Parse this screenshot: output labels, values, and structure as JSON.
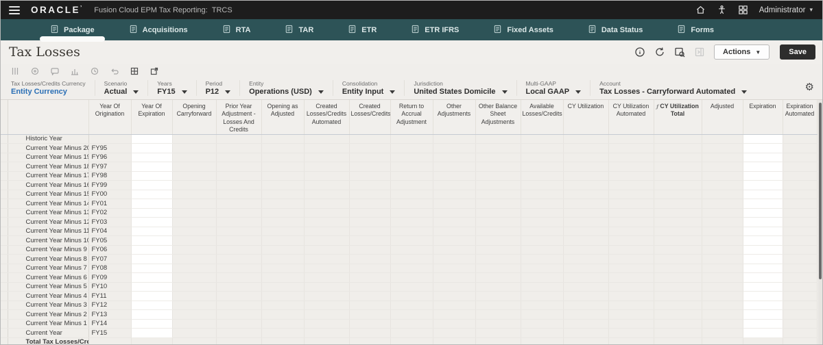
{
  "colors": {
    "topbar_bg": "#1d1d1d",
    "tabbar_bg": "#2d5357",
    "page_bg": "#f0eeeb",
    "link_blue": "#2a6fb5",
    "cell_readonly": "#f0eeea",
    "cell_editable": "#ffffff",
    "save_button_bg": "#2d2d2d"
  },
  "topbar": {
    "brand": "ORACLE",
    "product": "Fusion Cloud EPM Tax Reporting:",
    "app": "TRCS",
    "user": "Administrator",
    "icons": [
      "home-icon",
      "accessibility-icon",
      "apps-grid-icon"
    ]
  },
  "tabs": [
    {
      "id": "package",
      "label": "Package",
      "active": true
    },
    {
      "id": "acquisitions",
      "label": "Acquisitions",
      "active": false
    },
    {
      "id": "rta",
      "label": "RTA",
      "active": false
    },
    {
      "id": "tar",
      "label": "TAR",
      "active": false
    },
    {
      "id": "etr",
      "label": "ETR",
      "active": false
    },
    {
      "id": "etr-ifrs",
      "label": "ETR IFRS",
      "active": false
    },
    {
      "id": "fixed-assets",
      "label": "Fixed Assets",
      "active": false
    },
    {
      "id": "data-status",
      "label": "Data Status",
      "active": false
    },
    {
      "id": "forms",
      "label": "Forms",
      "active": false
    }
  ],
  "page": {
    "title": "Tax Losses",
    "actions_label": "Actions",
    "save_label": "Save",
    "title_icons": [
      "info-icon",
      "refresh-icon",
      "form-inspect-icon",
      "expand-panel-icon"
    ]
  },
  "toolbar_icons": [
    "freeze-columns-icon",
    "target-icon",
    "comment-icon",
    "chart-icon",
    "history-icon",
    "undo-icon",
    "grid-view-icon",
    "open-window-icon"
  ],
  "pov": [
    {
      "id": "currency",
      "label": "Tax Losses/Credits Currency",
      "value": "Entity Currency",
      "type": "link"
    },
    {
      "id": "scenario",
      "label": "Scenario",
      "value": "Actual",
      "type": "dropdown"
    },
    {
      "id": "years",
      "label": "Years",
      "value": "FY15",
      "type": "dropdown"
    },
    {
      "id": "period",
      "label": "Period",
      "value": "P12",
      "type": "dropdown"
    },
    {
      "id": "entity",
      "label": "Entity",
      "value": "Operations (USD)",
      "type": "dropdown"
    },
    {
      "id": "consolidation",
      "label": "Consolidation",
      "value": "Entity Input",
      "type": "dropdown"
    },
    {
      "id": "jurisdiction",
      "label": "Jurisdiction",
      "value": "United States Domicile",
      "type": "dropdown"
    },
    {
      "id": "multi-gaap",
      "label": "Multi-GAAP",
      "value": "Local GAAP",
      "type": "dropdown"
    },
    {
      "id": "account",
      "label": "Account",
      "value": "Tax Losses - Carryforward Automated",
      "type": "dropdown"
    }
  ],
  "table": {
    "columns": [
      "Year Of Origination",
      "Year Of Expiration",
      "Opening Carryforward",
      "Prior Year Adjustment - Losses And Credits",
      "Opening as Adjusted",
      "Created Losses/Credits Automated",
      "Created Losses/Credits",
      "Return to Accrual Adjustment",
      "Other Adjustments",
      "Other Balance Sheet Adjustments",
      "Available Losses/Credits",
      "CY Utilization",
      "CY Utilization Automated",
      "CY Utilization Total",
      "Adjusted",
      "Expiration",
      "Expiration Automated"
    ],
    "bold_column_index": 13,
    "formula_icon_column_index": 13,
    "editable_column_indexes": [
      1,
      15
    ],
    "rows": [
      {
        "label": "Historic Year",
        "origination": ""
      },
      {
        "label": "Current Year Minus 20",
        "origination": "FY95"
      },
      {
        "label": "Current Year Minus 19",
        "origination": "FY96"
      },
      {
        "label": "Current Year Minus 18",
        "origination": "FY97"
      },
      {
        "label": "Current Year Minus 17",
        "origination": "FY98"
      },
      {
        "label": "Current Year Minus 16",
        "origination": "FY99"
      },
      {
        "label": "Current Year Minus 15",
        "origination": "FY00"
      },
      {
        "label": "Current Year Minus 14",
        "origination": "FY01"
      },
      {
        "label": "Current Year Minus 13",
        "origination": "FY02"
      },
      {
        "label": "Current Year Minus 12",
        "origination": "FY03"
      },
      {
        "label": "Current Year Minus 11",
        "origination": "FY04"
      },
      {
        "label": "Current Year Minus 10",
        "origination": "FY05"
      },
      {
        "label": "Current Year Minus 9",
        "origination": "FY06"
      },
      {
        "label": "Current Year Minus 8",
        "origination": "FY07"
      },
      {
        "label": "Current Year Minus 7",
        "origination": "FY08"
      },
      {
        "label": "Current Year Minus 6",
        "origination": "FY09"
      },
      {
        "label": "Current Year Minus 5",
        "origination": "FY10"
      },
      {
        "label": "Current Year Minus 4",
        "origination": "FY11"
      },
      {
        "label": "Current Year Minus 3",
        "origination": "FY12"
      },
      {
        "label": "Current Year Minus 2",
        "origination": "FY13"
      },
      {
        "label": "Current Year Minus 1",
        "origination": "FY14"
      },
      {
        "label": "Current Year",
        "origination": "FY15"
      }
    ],
    "footer_row_label": "Total Tax Losses/Credits"
  }
}
